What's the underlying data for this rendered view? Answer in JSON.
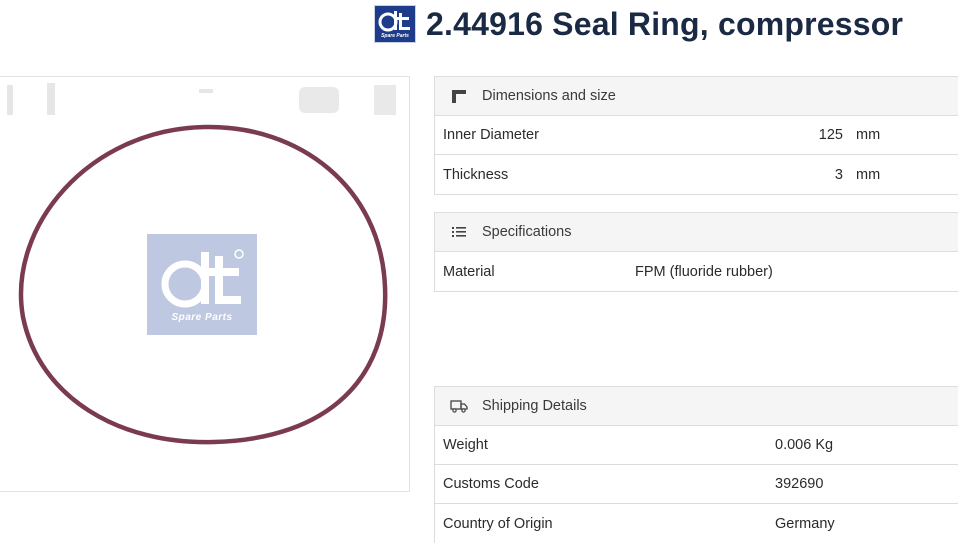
{
  "header": {
    "title": "2.44916 Seal Ring, compressor",
    "logo_text": "Spare Parts"
  },
  "image": {
    "watermark_text": "Spare Parts"
  },
  "dimensions": {
    "heading": "Dimensions and size",
    "rows": [
      {
        "label": "Inner Diameter",
        "value": "125",
        "unit": "mm"
      },
      {
        "label": "Thickness",
        "value": "3",
        "unit": "mm"
      }
    ]
  },
  "specifications": {
    "heading": "Specifications",
    "rows": [
      {
        "label": "Material",
        "value": "FPM (fluoride rubber)"
      }
    ]
  },
  "shipping": {
    "heading": "Shipping Details",
    "rows": [
      {
        "label": "Weight",
        "value": "0.006 Kg"
      },
      {
        "label": "Customs Code",
        "value": "392690"
      },
      {
        "label": "Country of Origin",
        "value": "Germany"
      }
    ]
  },
  "colors": {
    "ring": "#7a3b4e",
    "brand": "#1f3c8a",
    "heading_bg": "#f5f5f5",
    "border": "#dcdcdc",
    "title": "#1a2a44"
  },
  "icons": {
    "dimensions": "ruler-icon",
    "specifications": "list-icon",
    "shipping": "truck-icon"
  }
}
